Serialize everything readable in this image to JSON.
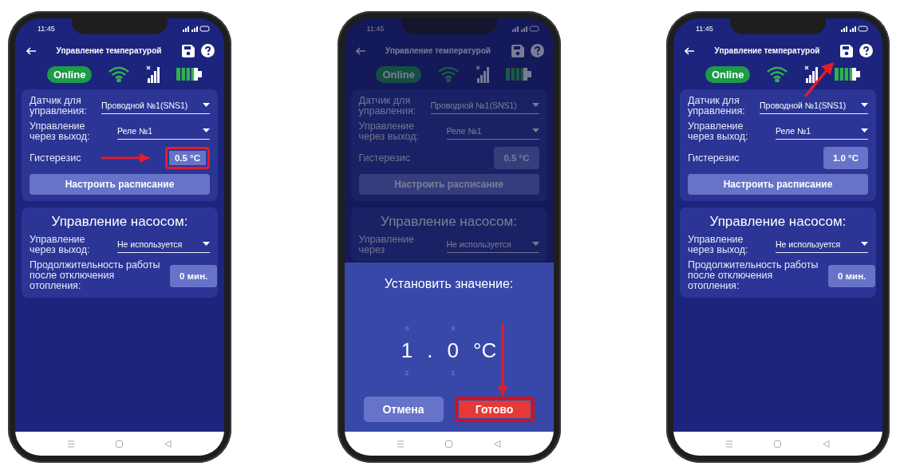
{
  "phones": [
    {
      "time": "11:45",
      "title": "Управление температурой",
      "status_badge": "Online",
      "dimmed": false,
      "annotation": {
        "kind": "right"
      },
      "settings": {
        "sensor": {
          "label": "Датчик для управления:",
          "value": "Проводной №1(SNS1)"
        },
        "output": {
          "label": "Управление через выход:",
          "value": "Реле №1"
        },
        "hysteresis": {
          "label": "Гистерезис",
          "value": "0.5 °C",
          "highlighted": true
        },
        "schedule_button": "Настроить расписание"
      },
      "pump": {
        "title": "Управление насосом:",
        "output": {
          "label": "Управление через выход:",
          "value": "Не используется"
        },
        "duration": {
          "label": "Продолжительность работы после отключения отопления:",
          "value": "0 мин."
        }
      }
    },
    {
      "time": "11:45",
      "title": "Управление температурой",
      "status_badge": "Online",
      "dimmed": true,
      "annotation": {
        "kind": "down"
      },
      "settings": {
        "sensor": {
          "label": "Датчик для управления:",
          "value": "Проводной №1(SNS1)"
        },
        "output": {
          "label": "Управление через выход:",
          "value": "Реле №1"
        },
        "hysteresis": {
          "label": "Гистерезис",
          "value": "0.5 °C",
          "highlighted": false
        },
        "schedule_button": "Настроить расписание"
      },
      "pump": {
        "title": "Управление насосом:",
        "output": {
          "label": "Управление через",
          "value": "Не используется"
        }
      },
      "dialog": {
        "title": "Установить значение:",
        "columns": [
          {
            "above": "0",
            "value": "1",
            "below": "2"
          },
          {
            "above": "9",
            "value": "0",
            "below": "1"
          }
        ],
        "separator": ".",
        "unit": "°C",
        "buttons": [
          {
            "label": "Отмена",
            "kind": "cancel",
            "highlighted": false
          },
          {
            "label": "Готово",
            "kind": "confirm",
            "highlighted": true
          }
        ]
      }
    },
    {
      "time": "11:45",
      "title": "Управление температурой",
      "status_badge": "Online",
      "dimmed": false,
      "annotation": {
        "kind": "up-right"
      },
      "settings": {
        "sensor": {
          "label": "Датчик для управления:",
          "value": "Проводной №1(SNS1)"
        },
        "output": {
          "label": "Управление через выход:",
          "value": "Реле №1"
        },
        "hysteresis": {
          "label": "Гистерезис",
          "value": "1.0 °C",
          "highlighted": false
        },
        "schedule_button": "Настроить расписание"
      },
      "pump": {
        "title": "Управление насосом:",
        "output": {
          "label": "Управление через выход:",
          "value": "Не используется"
        },
        "duration": {
          "label": "Продолжительность работы после отключения отопления:",
          "value": "0 мин."
        }
      }
    }
  ]
}
